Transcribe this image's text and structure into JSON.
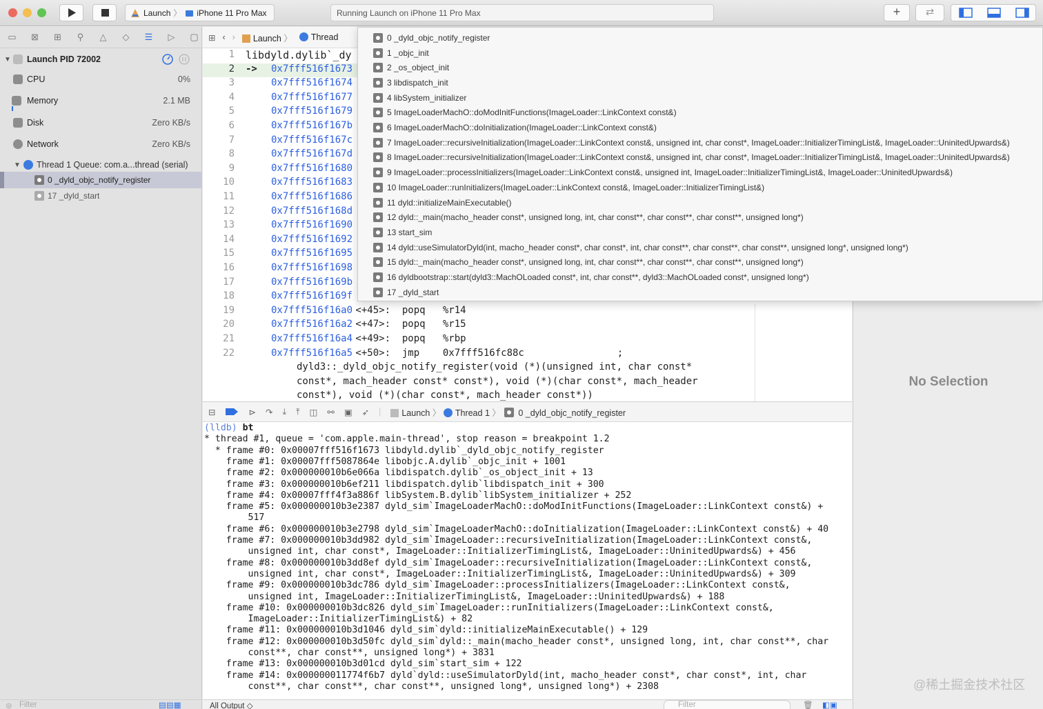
{
  "toolbar": {
    "scheme_target": "Launch",
    "scheme_device": "iPhone 11 Pro Max",
    "activity": "Running Launch on iPhone 11 Pro Max"
  },
  "navigator": {
    "process": "Launch PID 72002",
    "gauges": [
      {
        "label": "CPU",
        "value": "0%"
      },
      {
        "label": "Memory",
        "value": "2.1 MB"
      },
      {
        "label": "Disk",
        "value": "Zero KB/s"
      },
      {
        "label": "Network",
        "value": "Zero KB/s"
      }
    ],
    "thread": "Thread 1 Queue: com.a...thread (serial)",
    "frames": [
      "0 _dyld_objc_notify_register",
      "17 _dyld_start"
    ],
    "filter_placeholder": "Filter"
  },
  "editor": {
    "jump": [
      "Launch",
      "Thread"
    ],
    "header": "libdyld.dylib`_dy",
    "lines": [
      {
        "n": "1",
        "arrow": "",
        "addr": "",
        "rest": ""
      },
      {
        "n": "2",
        "arrow": "->",
        "addr": "0x7fff516f1673",
        "rest": ""
      },
      {
        "n": "3",
        "arrow": "",
        "addr": "0x7fff516f1674",
        "rest": ""
      },
      {
        "n": "4",
        "arrow": "",
        "addr": "0x7fff516f1677",
        "rest": ""
      },
      {
        "n": "5",
        "arrow": "",
        "addr": "0x7fff516f1679",
        "rest": ""
      },
      {
        "n": "6",
        "arrow": "",
        "addr": "0x7fff516f167b",
        "rest": ""
      },
      {
        "n": "7",
        "arrow": "",
        "addr": "0x7fff516f167c",
        "rest": ""
      },
      {
        "n": "8",
        "arrow": "",
        "addr": "0x7fff516f167d",
        "rest": ""
      },
      {
        "n": "9",
        "arrow": "",
        "addr": "0x7fff516f1680",
        "rest": ""
      },
      {
        "n": "10",
        "arrow": "",
        "addr": "0x7fff516f1683",
        "rest": ""
      },
      {
        "n": "11",
        "arrow": "",
        "addr": "0x7fff516f1686",
        "rest": ""
      },
      {
        "n": "12",
        "arrow": "",
        "addr": "0x7fff516f168d",
        "rest": ""
      },
      {
        "n": "13",
        "arrow": "",
        "addr": "0x7fff516f1690",
        "rest": ""
      },
      {
        "n": "14",
        "arrow": "",
        "addr": "0x7fff516f1692",
        "rest": ""
      },
      {
        "n": "15",
        "arrow": "",
        "addr": "0x7fff516f1695",
        "rest": ""
      },
      {
        "n": "16",
        "arrow": "",
        "addr": "0x7fff516f1698",
        "rest": ""
      },
      {
        "n": "17",
        "arrow": "",
        "addr": "0x7fff516f169b",
        "rest": ""
      },
      {
        "n": "18",
        "arrow": "",
        "addr": "0x7fff516f169f",
        "rest": ""
      },
      {
        "n": "19",
        "arrow": "",
        "addr": "0x7fff516f16a0",
        "rest": " <+45>:  popq   %r14"
      },
      {
        "n": "20",
        "arrow": "",
        "addr": "0x7fff516f16a2",
        "rest": " <+47>:  popq   %r15"
      },
      {
        "n": "21",
        "arrow": "",
        "addr": "0x7fff516f16a4",
        "rest": " <+49>:  popq   %rbp"
      },
      {
        "n": "22",
        "arrow": "",
        "addr": "0x7fff516f16a5",
        "rest": " <+50>:  jmp    0x7fff516fc88c                ;"
      }
    ],
    "comment": [
      "dyld3::_dyld_objc_notify_register(void (*)(unsigned int, char const*",
      "const*, mach_header const* const*), void (*)(char const*, mach_header",
      "const*), void (*)(char const*, mach_header const*))"
    ]
  },
  "popup": {
    "items": [
      "0 _dyld_objc_notify_register",
      "1 _objc_init",
      "2 _os_object_init",
      "3 libdispatch_init",
      "4 libSystem_initializer",
      "5 ImageLoaderMachO::doModInitFunctions(ImageLoader::LinkContext const&)",
      "6 ImageLoaderMachO::doInitialization(ImageLoader::LinkContext const&)",
      "7 ImageLoader::recursiveInitialization(ImageLoader::LinkContext const&, unsigned int, char const*, ImageLoader::InitializerTimingList&, ImageLoader::UninitedUpwards&)",
      "8 ImageLoader::recursiveInitialization(ImageLoader::LinkContext const&, unsigned int, char const*, ImageLoader::InitializerTimingList&, ImageLoader::UninitedUpwards&)",
      "9 ImageLoader::processInitializers(ImageLoader::LinkContext const&, unsigned int, ImageLoader::InitializerTimingList&, ImageLoader::UninitedUpwards&)",
      "10 ImageLoader::runInitializers(ImageLoader::LinkContext const&, ImageLoader::InitializerTimingList&)",
      "11 dyld::initializeMainExecutable()",
      "12 dyld::_main(macho_header const*, unsigned long, int, char const**, char const**, char const**, unsigned long*)",
      "13 start_sim",
      "14 dyld::useSimulatorDyld(int, macho_header const*, char const*, int, char const**, char const**, char const**, unsigned long*, unsigned long*)",
      "15 dyld::_main(macho_header const*, unsigned long, int, char const**, char const**, char const**, unsigned long*)",
      "16 dyldbootstrap::start(dyld3::MachOLoaded const*, int, char const**, dyld3::MachOLoaded const*, unsigned long*)",
      "17 _dyld_start"
    ]
  },
  "inspector": {
    "empty": "No Selection"
  },
  "debugbar": {
    "crumbs": [
      "Launch",
      "Thread 1",
      "0 _dyld_objc_notify_register"
    ]
  },
  "console": {
    "prompt": "(lldb)",
    "command": "bt",
    "lines": [
      "* thread #1, queue = 'com.apple.main-thread', stop reason = breakpoint 1.2",
      "  * frame #0: 0x00007fff516f1673 libdyld.dylib`_dyld_objc_notify_register",
      "    frame #1: 0x00007fff5087864e libobjc.A.dylib`_objc_init + 1001",
      "    frame #2: 0x000000010b6e066a libdispatch.dylib`_os_object_init + 13",
      "    frame #3: 0x000000010b6ef211 libdispatch.dylib`libdispatch_init + 300",
      "    frame #4: 0x00007fff4f3a886f libSystem.B.dylib`libSystem_initializer + 252",
      "    frame #5: 0x000000010b3e2387 dyld_sim`ImageLoaderMachO::doModInitFunctions(ImageLoader::LinkContext const&) +",
      "        517",
      "    frame #6: 0x000000010b3e2798 dyld_sim`ImageLoaderMachO::doInitialization(ImageLoader::LinkContext const&) + 40",
      "    frame #7: 0x000000010b3dd982 dyld_sim`ImageLoader::recursiveInitialization(ImageLoader::LinkContext const&,",
      "        unsigned int, char const*, ImageLoader::InitializerTimingList&, ImageLoader::UninitedUpwards&) + 456",
      "    frame #8: 0x000000010b3dd8ef dyld_sim`ImageLoader::recursiveInitialization(ImageLoader::LinkContext const&,",
      "        unsigned int, char const*, ImageLoader::InitializerTimingList&, ImageLoader::UninitedUpwards&) + 309",
      "    frame #9: 0x000000010b3dc786 dyld_sim`ImageLoader::processInitializers(ImageLoader::LinkContext const&,",
      "        unsigned int, ImageLoader::InitializerTimingList&, ImageLoader::UninitedUpwards&) + 188",
      "    frame #10: 0x000000010b3dc826 dyld_sim`ImageLoader::runInitializers(ImageLoader::LinkContext const&,",
      "        ImageLoader::InitializerTimingList&) + 82",
      "    frame #11: 0x000000010b3d1046 dyld_sim`dyld::initializeMainExecutable() + 129",
      "    frame #12: 0x000000010b3d50fc dyld_sim`dyld::_main(macho_header const*, unsigned long, int, char const**, char",
      "        const**, char const**, unsigned long*) + 3831",
      "    frame #13: 0x000000010b3d01cd dyld_sim`start_sim + 122",
      "    frame #14: 0x000000011774f6b7 dyld`dyld::useSimulatorDyld(int, macho_header const*, char const*, int, char",
      "        const**, char const**, char const**, unsigned long*, unsigned long*) + 2308"
    ]
  },
  "statusbar": {
    "output": "All Output ◇",
    "filter_placeholder": "Filter"
  },
  "watermark": "@稀土掘金技术社区"
}
